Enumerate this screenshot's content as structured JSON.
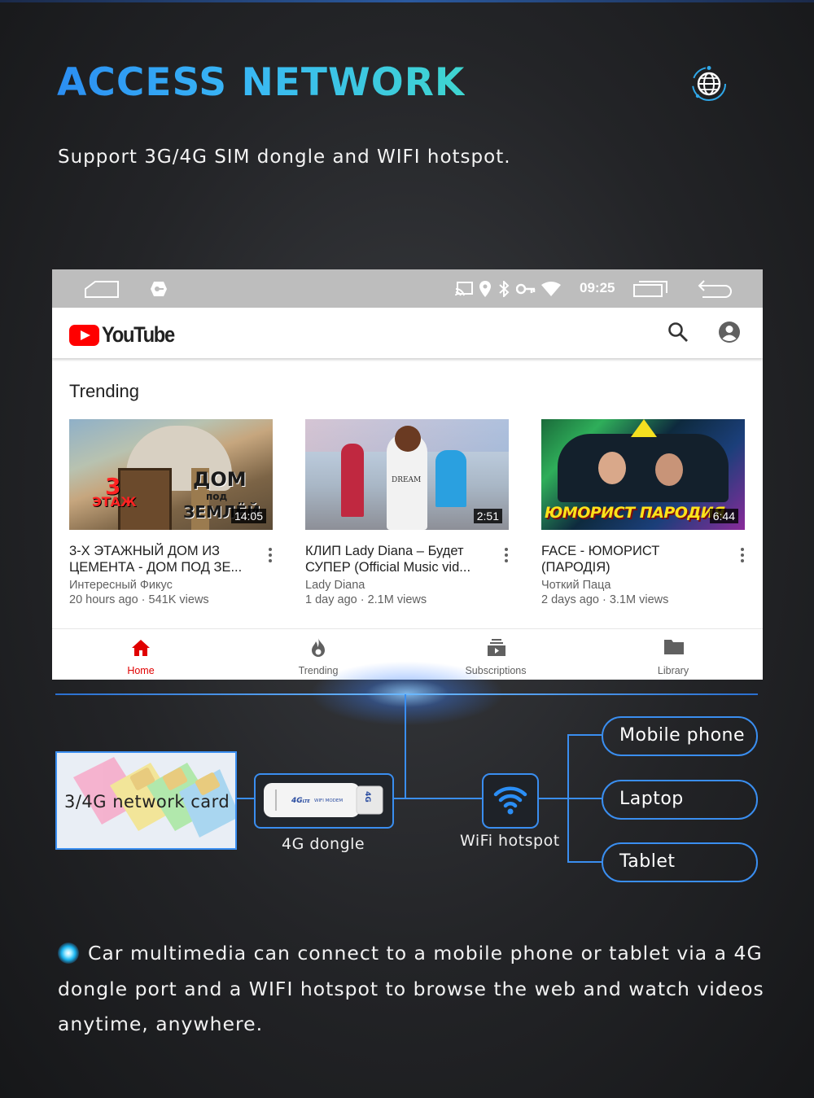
{
  "header": {
    "title_part1": "ACCESS",
    "title_part2": "NETWORK",
    "subtitle": "Support 3G/4G SIM dongle and WIFI hotspot."
  },
  "icons": {
    "header": "globe-network-icon",
    "statusbar": [
      "home-outline-icon",
      "car-key-icon",
      "cast-icon",
      "location-icon",
      "bluetooth-icon",
      "key-icon",
      "wifi-icon",
      "recent-apps-icon",
      "back-icon"
    ],
    "appbar": [
      "search-icon",
      "account-icon"
    ],
    "nav": [
      "home-icon",
      "trending-flame-icon",
      "subscriptions-icon",
      "library-folder-icon"
    ]
  },
  "colors": {
    "accent_blue": "#3a8ef0",
    "youtube_red": "#ff0000",
    "statusbar_gray": "#bdbdbd"
  },
  "screen": {
    "time": "09:25",
    "app_name": "YouTube",
    "section_title": "Trending",
    "videos": [
      {
        "title": "3-Х ЭТАЖНЫЙ ДОМ ИЗ ЦЕМЕНТА - ДОМ ПОД ЗЕ...",
        "channel": "Интересный Фикус",
        "meta": "20 hours ago · 541K views",
        "duration": "14:05",
        "thumb_text_1": "ДОМ",
        "thumb_text_2": "под",
        "thumb_text_3": "ЗЕМЛЁЙ",
        "thumb_text_4": "3",
        "thumb_text_5": "ЭТАЖ"
      },
      {
        "title": "КЛИП Lady Diana – Будет СУПЕР (Official Music vid...",
        "channel": "Lady Diana",
        "meta": "1 day ago · 2.1M views",
        "duration": "2:51",
        "thumb_text_1": "DREAM"
      },
      {
        "title": "FACE - ЮМОРИСТ (ПАРОДІЯ)",
        "channel": "Чоткий Паца",
        "meta": "2 days ago · 3.1M views",
        "duration": "6:44",
        "thumb_text_1": "ЮМОРИСТ ПАРОДИЯ"
      }
    ],
    "nav": [
      {
        "label": "Home",
        "active": true
      },
      {
        "label": "Trending",
        "active": false
      },
      {
        "label": "Subscriptions",
        "active": false
      },
      {
        "label": "Library",
        "active": false
      }
    ]
  },
  "diagram": {
    "sim_label": "3/4G network card",
    "dongle_label": "4G dongle",
    "dongle_print_1": "4G",
    "dongle_print_2": "LTE",
    "dongle_print_3": "WIFI MODEM",
    "dongle_print_4": "4G",
    "hotspot_label": "WiFi hotspot",
    "devices": [
      "Mobile phone",
      "Laptop",
      "Tablet"
    ]
  },
  "footer": {
    "text": "Car multimedia can connect to a mobile phone or tablet via a 4G dongle port and a WIFI hotspot to browse the web and watch videos anytime, anywhere."
  }
}
